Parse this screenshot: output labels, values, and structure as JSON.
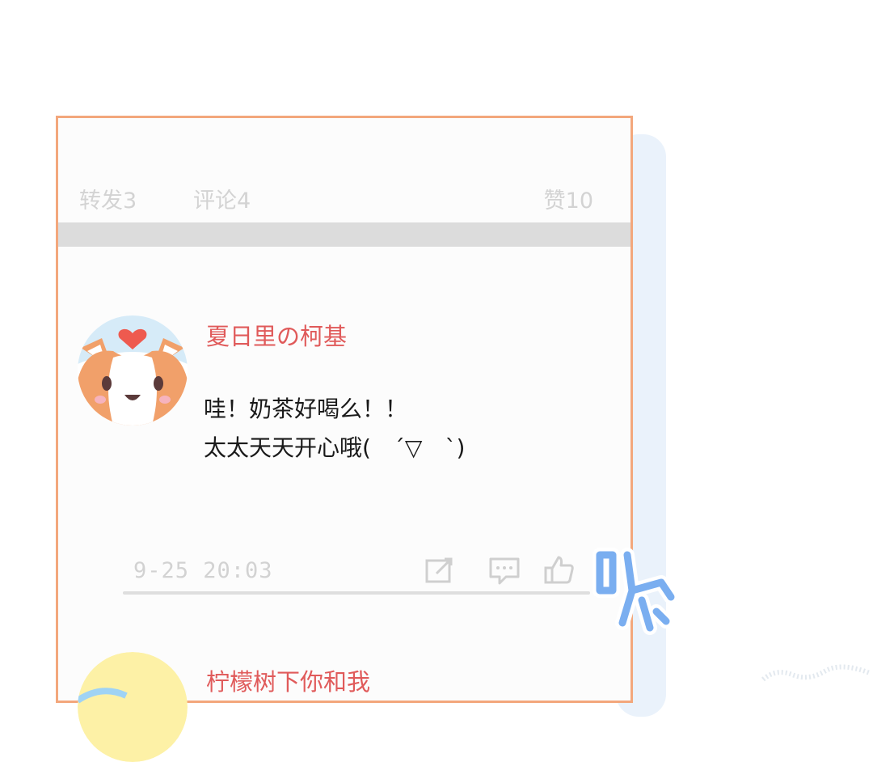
{
  "post": {
    "stats": {
      "repost": "转发3",
      "comment": "评论4",
      "like": "赞10"
    }
  },
  "comments": [
    {
      "username": "夏日里の柯基",
      "lines": [
        "哇！奶茶好喝么！！",
        "太太天天开心哦(　´▽　`)"
      ],
      "timestamp": "9-25  20:03",
      "icons": [
        "share-icon",
        "reply-icon",
        "thumbs-up-icon"
      ]
    },
    {
      "username": "柠檬树下你和我"
    }
  ],
  "overlay": {
    "sound_effect": "咻"
  },
  "colors": {
    "frame_border": "#f3a77c",
    "username": "#e05a5a",
    "sfx_blue": "#7aaef0"
  }
}
